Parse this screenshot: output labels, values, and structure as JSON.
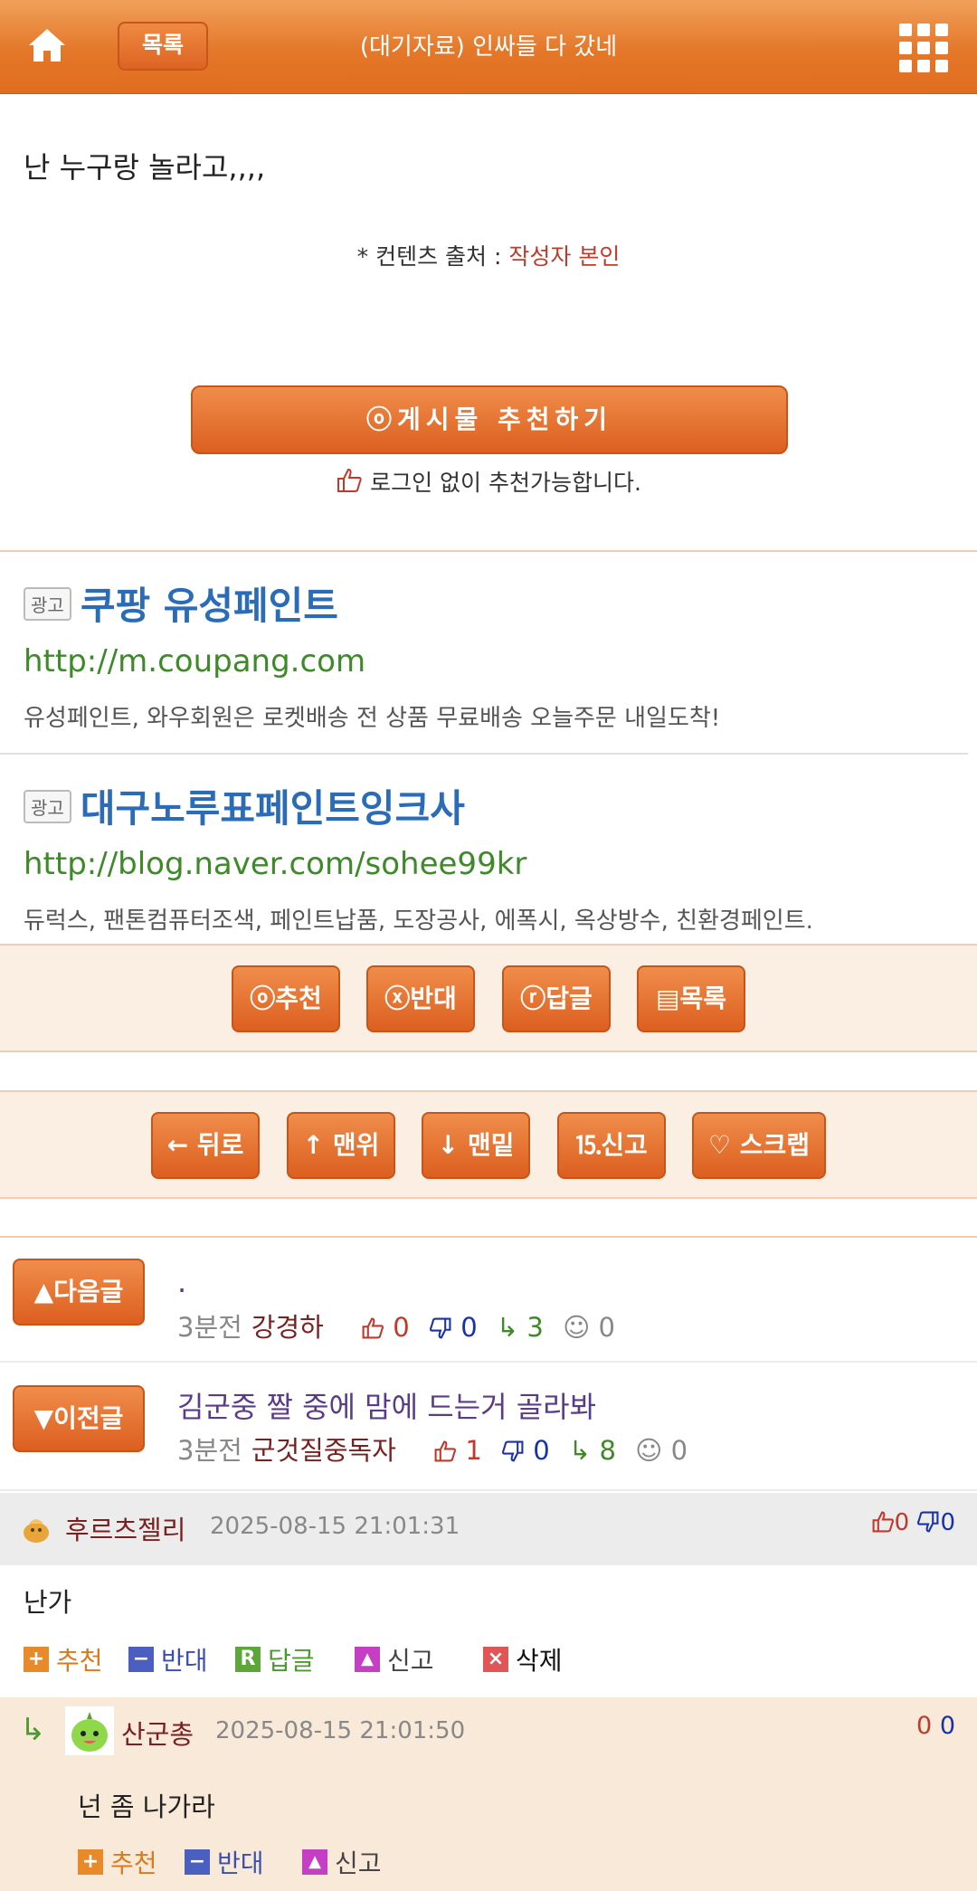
{
  "header": {
    "list_label": "목록",
    "title": "(대기자료) 인싸들 다 갔네"
  },
  "post": {
    "text": "난 누구랑 놀라고,,,,",
    "source_label": "* 컨텐츠 출처 : ",
    "source_value": "작성자 본인",
    "recommend_label": "ⓞ게시물  추천하기",
    "recommend_note": "로그인 없이 추천가능합니다."
  },
  "ads": [
    {
      "badge": "광고",
      "title": "쿠팡 유성페인트",
      "url": "http://m.coupang.com",
      "desc": "유성페인트, 와우회원은 로켓배송 전 상품 무료배송 오늘주문 내일도착!"
    },
    {
      "badge": "광고",
      "title": "대구노루표페인트잉크사",
      "url": "http://blog.naver.com/sohee99kr",
      "desc": "듀럭스, 팬톤컴퓨터조색, 페인트납품, 도장공사, 에폭시, 옥상방수, 친환경페인트."
    }
  ],
  "action_bar": {
    "recommend": "ⓞ추천",
    "oppose": "ⓧ반대",
    "reply": "ⓡ답글",
    "list": "▤목록"
  },
  "nav_bar": {
    "back": "← 뒤로",
    "top": "↑ 맨위",
    "bottom": "↓ 맨밑",
    "report": "신고",
    "scrap": "♡ 스크랩"
  },
  "next_post": {
    "label": "▲다음글",
    "title": ".",
    "time": "3분전",
    "author": "강경하",
    "up": "0",
    "down": "0",
    "replies": "3",
    "smile": "0"
  },
  "prev_post": {
    "label": "▼이전글",
    "title": "김군중 짤 중에 맘에 드는거 골라봐",
    "time": "3분전",
    "author": "군것질중독자",
    "up": "1",
    "down": "0",
    "replies": "8",
    "smile": "0"
  },
  "comments": [
    {
      "author": "후르츠젤리",
      "date": "2025-08-15 21:01:31",
      "up": "0",
      "down": "0",
      "text": "난가",
      "actions": {
        "recommend": "추천",
        "oppose": "반대",
        "reply": "답글",
        "report": "신고",
        "delete": "삭제"
      }
    },
    {
      "author": "산군총",
      "date": "2025-08-15 21:01:50",
      "up": "0",
      "down": "0",
      "text": "넌 좀 나가라",
      "actions": {
        "recommend": "추천",
        "oppose": "반대",
        "report": "신고"
      }
    }
  ],
  "colors": {
    "accent": "#e47729",
    "ad_title": "#2b6cb8",
    "ad_url": "#3d8a28",
    "author": "#7a2020"
  }
}
